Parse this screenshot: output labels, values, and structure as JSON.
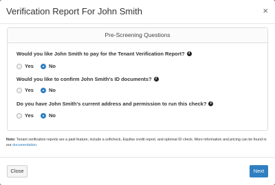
{
  "modal": {
    "title": "Verification Report For John Smith",
    "close_glyph": "×"
  },
  "panel": {
    "heading": "Pre-Screening Questions",
    "questions": [
      {
        "text": "Would you like John Smith to pay for the Tenant Verification Report?",
        "options": [
          "Yes",
          "No"
        ],
        "selected": "No"
      },
      {
        "text": "Would you like to confirm John Smith's ID documents?",
        "options": [
          "Yes",
          "No"
        ],
        "selected": "No"
      },
      {
        "text": "Do you have John Smith's current address and permission to run this check?",
        "options": [
          "Yes",
          "No"
        ],
        "selected": "No"
      }
    ]
  },
  "note": {
    "label": "Note:",
    "text": " Tenant verification reports are a paid feature, include a softcheck, Equifax credit report, and optional ID check. More information and pricing can be found in our ",
    "link": "documentation",
    "end": "."
  },
  "footer": {
    "close_label": "Close",
    "next_label": "Next"
  },
  "colors": {
    "accent": "#2f7fc1"
  },
  "icons": {
    "info": "info-icon",
    "close": "close-icon"
  }
}
